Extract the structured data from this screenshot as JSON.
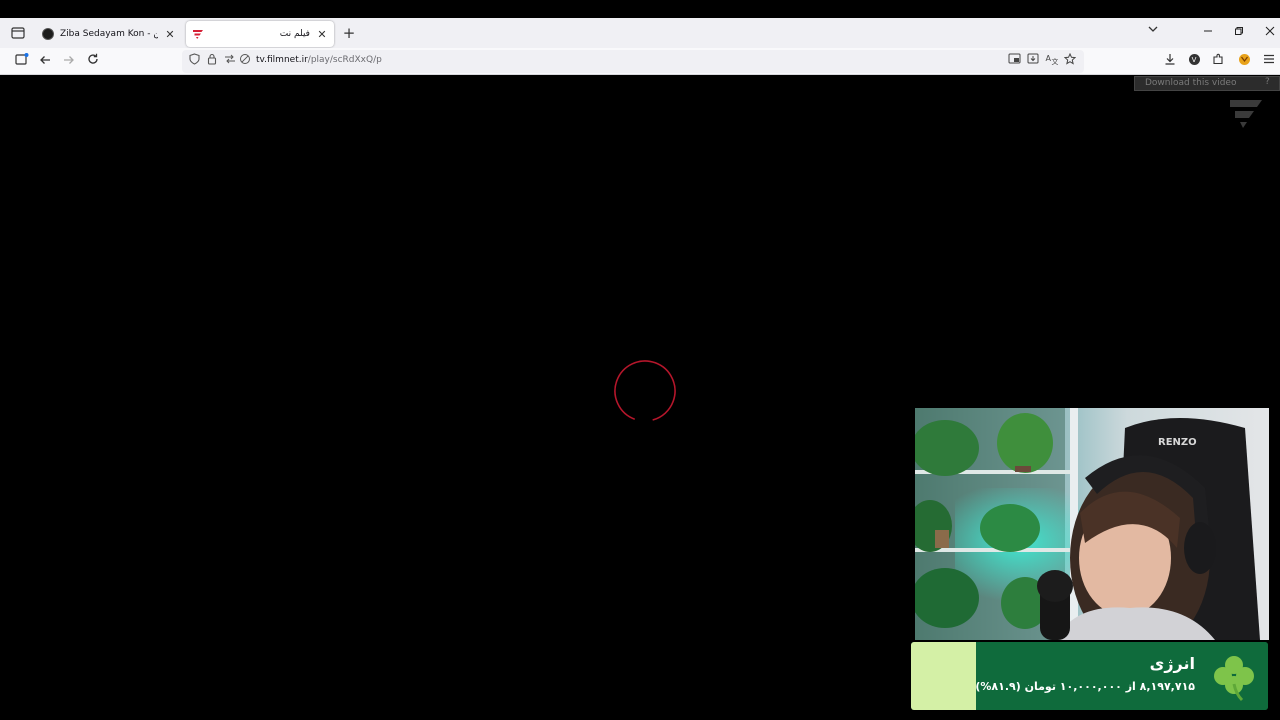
{
  "browser": {
    "tabs": [
      {
        "title": "Ziba Sedayam Kon - صدایم کن",
        "active": false,
        "close_label": "✕"
      },
      {
        "title": "فیلم نت",
        "active": true,
        "close_label": "✕"
      }
    ],
    "new_tab_label": "+",
    "url": {
      "host": "tv.filmnet.ir",
      "path": "/play/scRdXxQ/p"
    }
  },
  "video": {
    "download_label": "Download this video",
    "download_help": "?",
    "state": "loading",
    "spinner_color": "#b5162b"
  },
  "stream_goal": {
    "title": "انرژی",
    "amount_text": "۸,۱۹۷,۷۱۵ از ۱۰,۰۰۰,۰۰۰ تومان (۸۱.۹%)",
    "progress_fraction": 0.819,
    "icon": "clover-icon",
    "colors": {
      "panel": "#0f6b3c",
      "fill": "#d4f0a6",
      "icon": "#7ec44a"
    }
  },
  "webcam": {
    "headset_brand": "RENZO"
  }
}
